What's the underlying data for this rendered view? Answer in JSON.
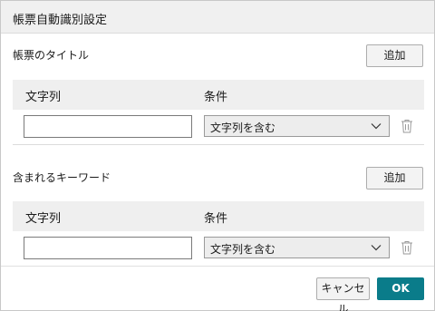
{
  "dialog": {
    "title": "帳票自動識別設定"
  },
  "sections": [
    {
      "label": "帳票のタイトル",
      "add_label": "追加",
      "columns": [
        "文字列",
        "条件"
      ],
      "row": {
        "text_value": "",
        "condition": "文字列を含む"
      }
    },
    {
      "label": "含まれるキーワード",
      "add_label": "追加",
      "columns": [
        "文字列",
        "条件"
      ],
      "row": {
        "text_value": "",
        "condition": "文字列を含む"
      }
    }
  ],
  "footer": {
    "cancel_label": "キャンセル",
    "ok_label": "OK"
  },
  "colors": {
    "accent": "#0a7c8a",
    "header_bg": "#efefef"
  },
  "icons": [
    "chevron-down-icon",
    "trash-icon"
  ]
}
